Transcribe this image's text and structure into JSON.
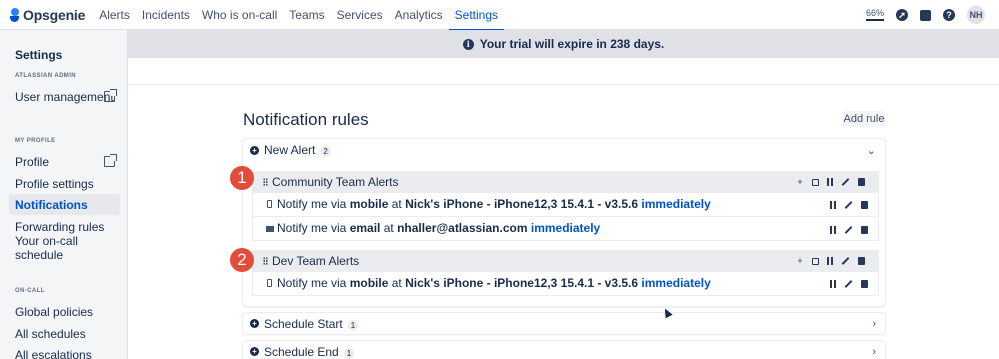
{
  "nav": {
    "brand": "Opsgenie",
    "items": [
      {
        "label": "Alerts"
      },
      {
        "label": "Incidents"
      },
      {
        "label": "Who is on-call"
      },
      {
        "label": "Teams"
      },
      {
        "label": "Services"
      },
      {
        "label": "Analytics"
      },
      {
        "label": "Settings",
        "active": true
      }
    ],
    "zoom": "66%",
    "help_glyph": "?",
    "avatar_initials": "NH"
  },
  "sidebar": {
    "title": "Settings",
    "sections": [
      {
        "heading": "ATLASSIAN ADMIN",
        "items": [
          {
            "label": "User management",
            "external": true
          }
        ]
      },
      {
        "heading": "MY PROFILE",
        "items": [
          {
            "label": "Profile",
            "external": true
          },
          {
            "label": "Profile settings"
          },
          {
            "label": "Notifications",
            "active": true
          },
          {
            "label": "Forwarding rules"
          },
          {
            "label": "Your on-call schedule"
          }
        ]
      },
      {
        "heading": "ON-CALL",
        "items": [
          {
            "label": "Global policies"
          },
          {
            "label": "All schedules"
          },
          {
            "label": "All escalations"
          }
        ]
      }
    ]
  },
  "banner": {
    "icon_glyph": "i",
    "text": "Your trial will expire in 238 days."
  },
  "main": {
    "title": "Notification rules",
    "add_rule_label": "Add rule",
    "groups": [
      {
        "name": "New Alert",
        "count": "2",
        "expanded": true,
        "rules": [
          {
            "name": "Community Team Alerts",
            "badge": "1",
            "notifications": [
              {
                "prefix": "Notify me via",
                "method": "mobile",
                "at": "at",
                "target": "Nick's iPhone - iPhone12,3 15.4.1 - v3.5.6",
                "when": "immediately"
              },
              {
                "prefix": "Notify me via",
                "method": "email",
                "at": "at",
                "target": "nhaller@atlassian.com",
                "when": "immediately"
              }
            ]
          },
          {
            "name": "Dev Team Alerts",
            "badge": "2",
            "notifications": [
              {
                "prefix": "Notify me via",
                "method": "mobile",
                "at": "at",
                "target": "Nick's iPhone - iPhone12,3 15.4.1 - v3.5.6",
                "when": "immediately"
              }
            ]
          }
        ]
      },
      {
        "name": "Schedule Start",
        "count": "1",
        "expanded": false
      },
      {
        "name": "Schedule End",
        "count": "1",
        "expanded": false
      }
    ]
  },
  "icons": {
    "add": "plus-icon",
    "copy": "copy-icon",
    "pause": "pause-icon",
    "edit": "edit-icon",
    "delete": "trash-icon",
    "expand": "chevron-down-icon",
    "collapsed": "chevron-right-icon"
  },
  "colors": {
    "accent": "#0052cc",
    "badge": "#e34c39",
    "banner_bg": "#dfe1e6",
    "sidebar_bg": "#f4f5f7"
  }
}
